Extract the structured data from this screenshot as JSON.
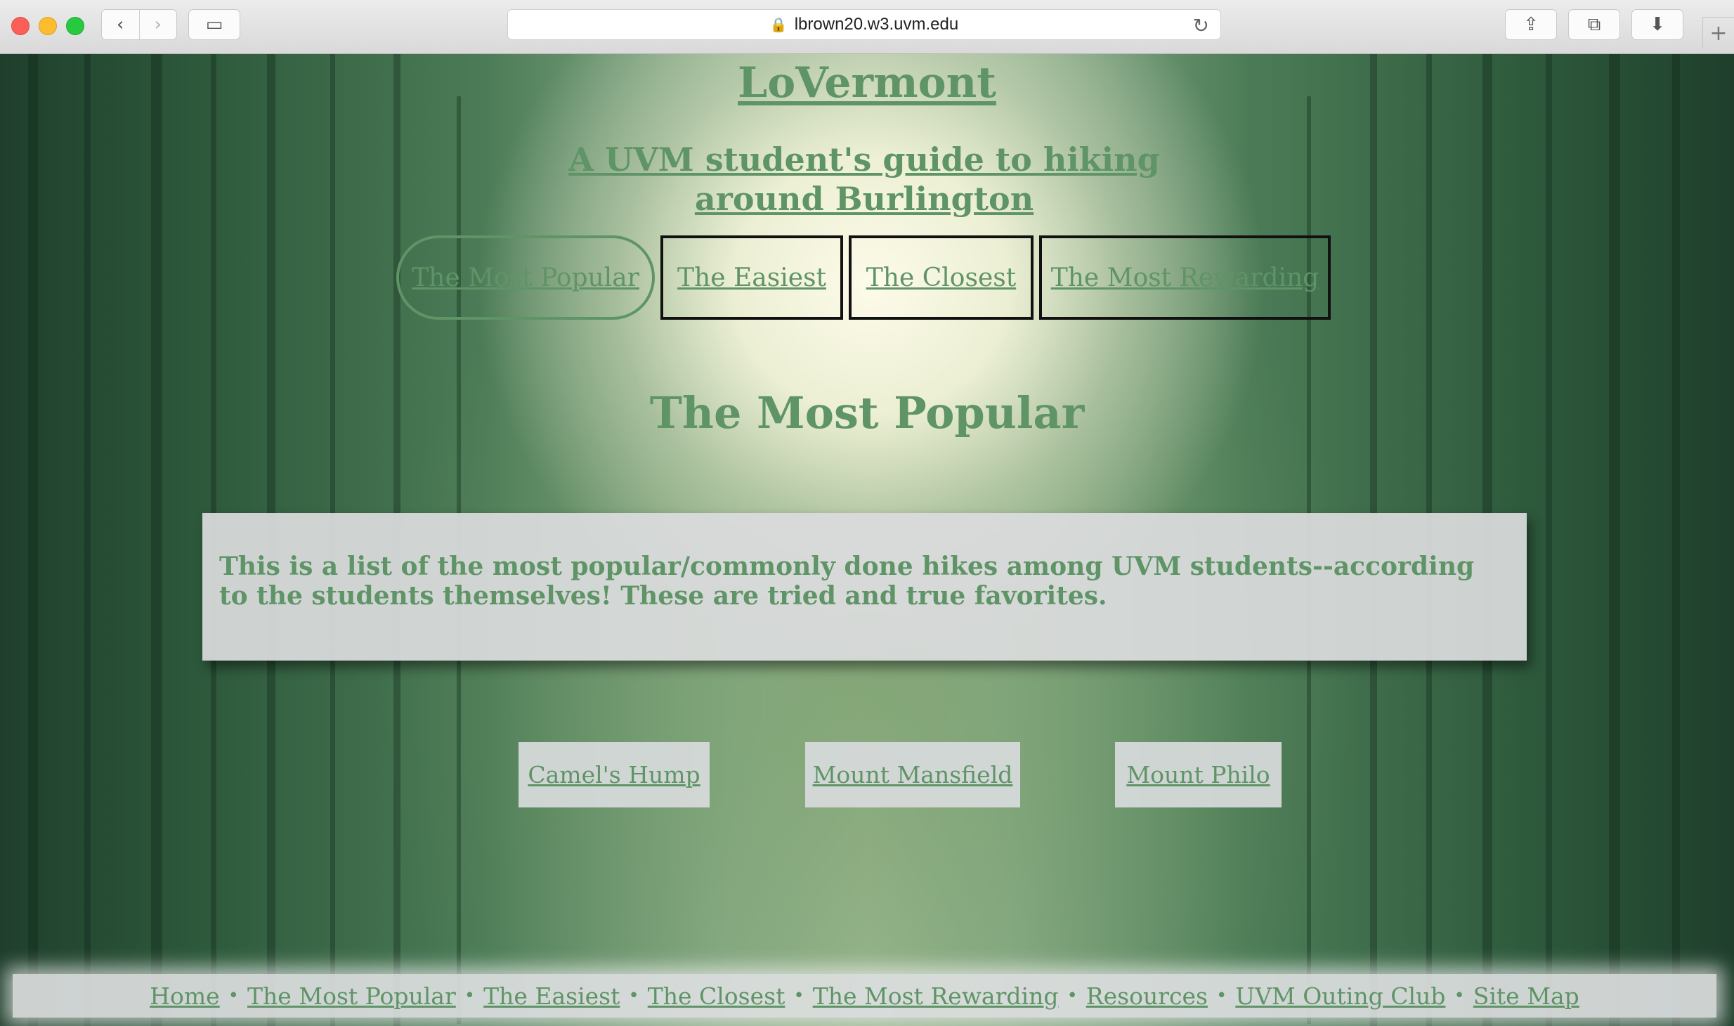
{
  "browser": {
    "url": "lbrown20.w3.uvm.edu",
    "back_glyph": "‹",
    "forward_glyph": "›",
    "sidebar_glyph": "▭",
    "share_glyph": "⇪",
    "tabs_glyph": "⧉",
    "download_glyph": "⬇",
    "lock_glyph": "🔒",
    "reload_glyph": "↻",
    "newtab_glyph": "+"
  },
  "header": {
    "title": "LoVermont",
    "tagline": "A UVM student's guide to hiking around Burlington"
  },
  "nav_tabs": [
    {
      "label": "The Most Popular",
      "active": true
    },
    {
      "label": "The Easiest"
    },
    {
      "label": "The Closest"
    },
    {
      "label": "The Most Rewarding"
    }
  ],
  "main": {
    "heading": "The Most Popular",
    "intro": "This is a list of the most popular/commonly done hikes among UVM students--according to the students themselves! These are tried and true favorites.",
    "hikes": [
      "Camel's Hump",
      "Mount Mansfield",
      "Mount Philo"
    ]
  },
  "footer": {
    "links": [
      "Home",
      "The Most Popular",
      "The Easiest",
      "The Closest",
      "The Most Rewarding",
      "Resources",
      "UVM Outing Club",
      "Site Map"
    ],
    "separator": "•"
  },
  "colors": {
    "accent_green": "#5f9467",
    "tab_border": "#111111"
  }
}
